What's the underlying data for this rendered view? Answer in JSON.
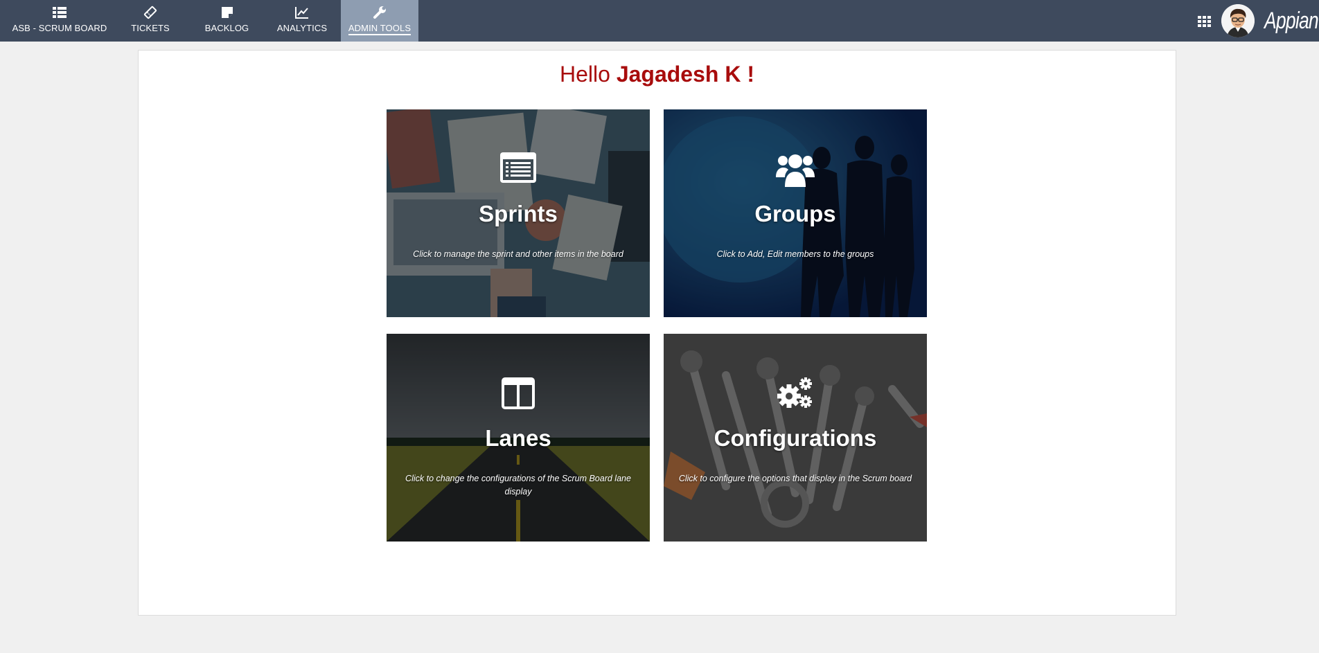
{
  "nav": {
    "tabs": [
      {
        "label": "ASB - SCRUM BOARD",
        "icon": "list-icon"
      },
      {
        "label": "TICKETS",
        "icon": "ticket-icon"
      },
      {
        "label": "BACKLOG",
        "icon": "note-icon"
      },
      {
        "label": "ANALYTICS",
        "icon": "line-chart-icon"
      },
      {
        "label": "ADMIN TOOLS",
        "icon": "wrench-icon",
        "active": true
      }
    ],
    "logo": "Appian",
    "apps_icon": "grid-icon"
  },
  "greeting": {
    "prefix": "Hello",
    "name": "Jagadesh K !"
  },
  "tiles": [
    {
      "title": "Sprints",
      "description": "Click to manage the sprint and other items in the board",
      "icon": "list-card-icon"
    },
    {
      "title": "Groups",
      "description": "Click to Add, Edit members to the groups",
      "icon": "users-icon"
    },
    {
      "title": "Lanes",
      "description": "Click to change the configurations of the Scrum Board lane display",
      "icon": "columns-icon"
    },
    {
      "title": "Configurations",
      "description": "Click to configure the options that display in the Scrum board",
      "icon": "gears-icon"
    }
  ],
  "colors": {
    "topbar": "#3e4a5d",
    "active_tab": "#8e9db1",
    "greeting": "#a80d0d",
    "page_bg": "#f0f0f0"
  }
}
